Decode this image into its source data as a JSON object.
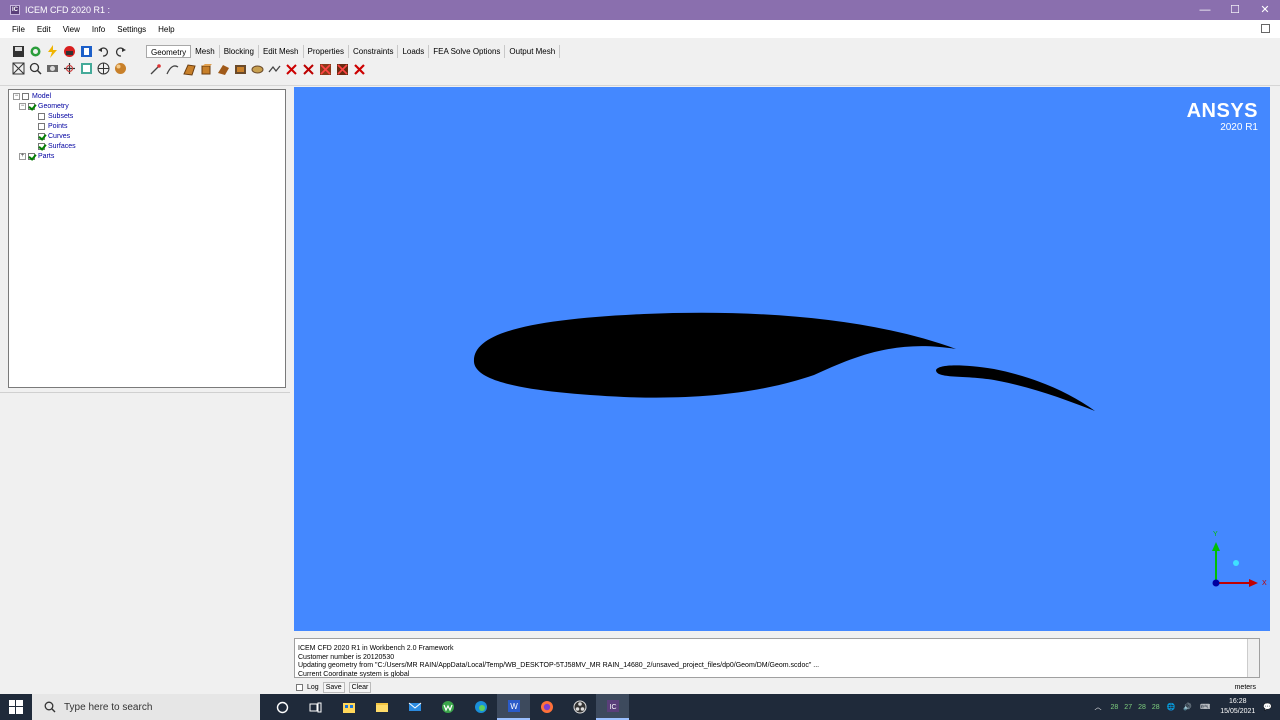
{
  "window": {
    "title": "ICEM CFD 2020 R1 :",
    "app_icon_text": "IC",
    "controls": [
      "—",
      "☐",
      "✕"
    ]
  },
  "menu": [
    "File",
    "Edit",
    "View",
    "Info",
    "Settings",
    "Help"
  ],
  "tabs": [
    {
      "label": "Geometry",
      "active": true
    },
    {
      "label": "Mesh",
      "active": false
    },
    {
      "label": "Blocking",
      "active": false
    },
    {
      "label": "Edit Mesh",
      "active": false
    },
    {
      "label": "Properties",
      "active": false
    },
    {
      "label": "Constraints",
      "active": false
    },
    {
      "label": "Loads",
      "active": false
    },
    {
      "label": "FEA Solve Options",
      "active": false
    },
    {
      "label": "Output Mesh",
      "active": false
    }
  ],
  "tree": {
    "model": "Model",
    "geometry": "Geometry",
    "subsets": "Subsets",
    "points": "Points",
    "curves": "Curves",
    "surfaces": "Surfaces",
    "parts": "Parts"
  },
  "viewport": {
    "brand": "ANSYS",
    "version": "2020 R1",
    "background": "#4488ff",
    "axis_labels": {
      "x": "X",
      "y": "Y"
    }
  },
  "messages": [
    "ICEM CFD 2020 R1 in Workbench 2.0 Framework",
    "Customer number is 20120530",
    "Updating geometry from \"C:/Users/MR RAIN/AppData/Local/Temp/WB_DESKTOP-5TJ58MV_MR RAIN_14680_2/unsaved_project_files/dp0/Geom/DM/Geom.scdoc\" ...",
    "Current Coordinate system is global"
  ],
  "msg_controls": {
    "log": "Log",
    "save": "Save",
    "clear": "Clear"
  },
  "units": "meters",
  "taskbar": {
    "search_placeholder": "Type here to search",
    "tray_numbers": [
      "28",
      "27",
      "28",
      "28"
    ],
    "time": "16:28",
    "date": "15/05/2021"
  }
}
